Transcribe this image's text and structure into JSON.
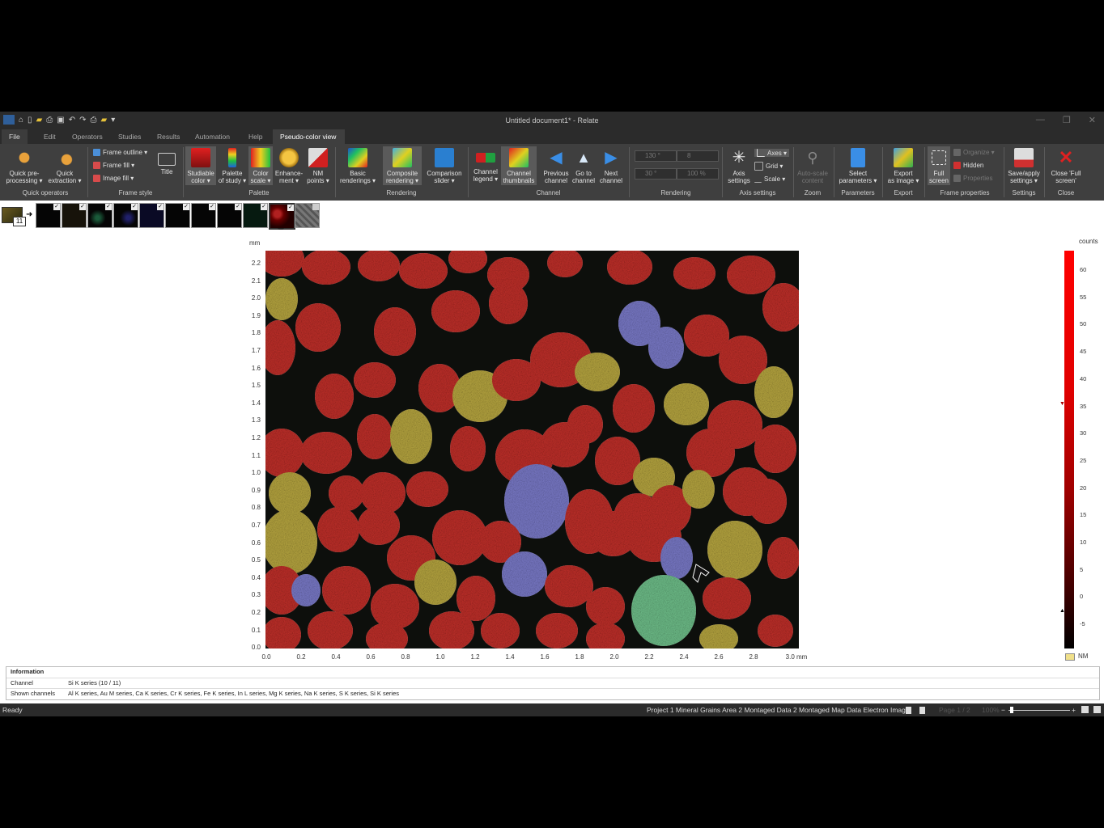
{
  "app": {
    "title": "Untitled document1* - Relate"
  },
  "menu": [
    "File",
    "Edit",
    "Operators",
    "Studies",
    "Results",
    "Automation",
    "Help",
    "Pseudo-color view"
  ],
  "ribbon": {
    "quick_preprocessing": "Quick pre-\nprocessing ▾",
    "quick_extraction": "Quick\nextraction ▾",
    "group_quick_operators": "Quick operators",
    "frame_outline": "Frame outline ▾",
    "frame_fill": "Frame fill ▾",
    "image_fill": "Image fill ▾",
    "title": "Title",
    "group_frame_style": "Frame style",
    "studiable_color": "Studiable\ncolor ▾",
    "palette_of_study": "Palette\nof study ▾",
    "color_scale": "Color\nscale ▾",
    "enhancement": "Enhance-\nment ▾",
    "nm_points": "NM\npoints ▾",
    "group_palette": "Palette",
    "basic_renderings": "Basic\nrenderings ▾",
    "composite_rendering": "Composite\nrendering ▾",
    "comparison_slider": "Comparison\nslider ▾",
    "group_rendering": "Rendering",
    "channel_legend": "Channel\nlegend ▾",
    "channel_thumbnails": "Channel\nthumbnails",
    "previous_channel": "Previous\nchannel",
    "go_to_channel": "Go to\nchannel",
    "next_channel": "Next\nchannel",
    "group_channel": "Channel",
    "render_val1": "130 °",
    "render_val2": "30 °",
    "render_val3": "8",
    "render_val4": "100 %",
    "group_rendering2": "Rendering",
    "axis_settings": "Axis\nsettings",
    "axes": "Axes ▾",
    "grid": "Grid ▾",
    "scale": "Scale ▾",
    "group_axis_settings": "Axis settings",
    "auto_scale": "Auto-scale\ncontent",
    "group_zoom": "Zoom",
    "select_parameters": "Select\nparameters ▾",
    "group_parameters": "Parameters",
    "export_as_image": "Export\nas image ▾",
    "group_export": "Export",
    "full_screen": "Full\nscreen",
    "organize": "Organize ▾",
    "hidden": "Hidden",
    "properties": "Properties",
    "group_frame_properties": "Frame properties",
    "save_apply": "Save/apply\nsettings ▾",
    "group_settings": "Settings",
    "close_full_screen": "Close 'Full\nscreen'",
    "group_close": "Close"
  },
  "thumbnails": {
    "stack_count": "11"
  },
  "plot": {
    "y_unit": "mm",
    "x_unit": "mm",
    "y_ticks": [
      "2.2",
      "2.1",
      "2.0",
      "1.9",
      "1.8",
      "1.7",
      "1.6",
      "1.5",
      "1.4",
      "1.3",
      "1.2",
      "1.1",
      "1.0",
      "0.9",
      "0.8",
      "0.7",
      "0.6",
      "0.5",
      "0.4",
      "0.3",
      "0.2",
      "0.1",
      "0.0"
    ],
    "x_ticks": [
      "0.0",
      "0.2",
      "0.4",
      "0.6",
      "0.8",
      "1.0",
      "1.2",
      "1.4",
      "1.6",
      "1.8",
      "2.0",
      "2.2",
      "2.4",
      "2.6",
      "2.8",
      "3.0 mm"
    ],
    "colorbar_unit": "counts",
    "colorbar_ticks": [
      "60",
      "55",
      "50",
      "45",
      "40",
      "35",
      "30",
      "25",
      "20",
      "15",
      "10",
      "5",
      "0",
      "-5"
    ],
    "nm_label": "NM",
    "colors": {
      "grain_red": "#c0302a",
      "grain_yellow": "#b7a640",
      "grain_blue": "#7a7ac8",
      "grain_green": "#6fbf8a",
      "background": "#0d0f0c"
    }
  },
  "info": {
    "header": "Information",
    "channel_key": "Channel",
    "channel_value": "Si K series (10 / 11)",
    "shown_key": "Shown channels",
    "shown_value": "Al K series, Au M series, Ca K series, Cr K series, Fe K series, In L series, Mg K series, Na K series, S K series, Si K series"
  },
  "status": {
    "left": "Ready",
    "path": "Project 1  Mineral Grains Area 2  Montaged Data 2  Montaged Map Data Electron Imag",
    "page": "Page 1 / 2",
    "zoom": "100%"
  }
}
